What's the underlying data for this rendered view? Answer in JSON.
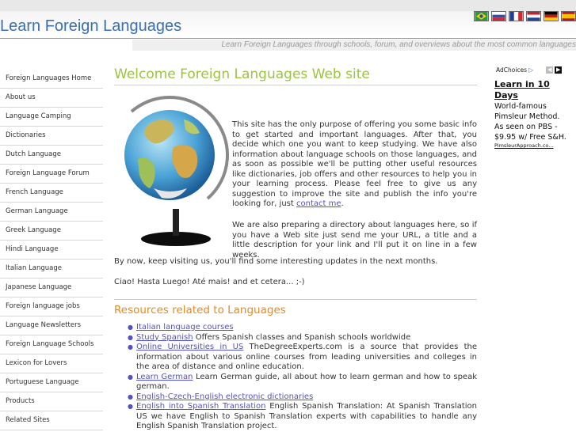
{
  "site": {
    "title": "Learn Foreign Languages",
    "tagline": "Learn Foreign Languages through schools, forum, and overviews about the most common languages"
  },
  "flags": [
    {
      "name": "brazil-flag",
      "colors": [
        "#2a9a3a",
        "#f4d21b",
        "#2c4aa0"
      ]
    },
    {
      "name": "russia-flag",
      "colors": [
        "#ffffff",
        "#2b50b5",
        "#d6262e"
      ]
    },
    {
      "name": "france-flag",
      "colors": [
        "#1f3e9c",
        "#ffffff",
        "#d6262e"
      ]
    },
    {
      "name": "netherlands-flag",
      "colors": [
        "#c8202e",
        "#ffffff",
        "#20439b"
      ]
    },
    {
      "name": "germany-flag",
      "colors": [
        "#000000",
        "#dd1010",
        "#ffcc00"
      ]
    },
    {
      "name": "spain-flag",
      "colors": [
        "#c7102e",
        "#f3c300",
        "#c7102e"
      ]
    }
  ],
  "sidebar": {
    "items": [
      {
        "label": "Foreign Languages Home"
      },
      {
        "label": "About us"
      },
      {
        "label": "Language Camping"
      },
      {
        "label": "Dictionaries"
      },
      {
        "label": "Dutch Language"
      },
      {
        "label": "Foreign Language Forum"
      },
      {
        "label": "French Language"
      },
      {
        "label": "German Language"
      },
      {
        "label": "Greek Language"
      },
      {
        "label": "Hindi Language"
      },
      {
        "label": "Italian Language"
      },
      {
        "label": "Japanese Language"
      },
      {
        "label": "Foreign language jobs"
      },
      {
        "label": "Language Newsletters"
      },
      {
        "label": "Foreign Language Schools"
      },
      {
        "label": "Lexicon for Lovers"
      },
      {
        "label": "Portuguese Language"
      },
      {
        "label": "Products"
      },
      {
        "label": "Related Sites"
      }
    ]
  },
  "main": {
    "title": "Welcome Foreign Languages Web site",
    "intro_text": "This site has the only purpose of offering you some basic info to get started and important languages. After that, you decide which one you want to keep studying. We have also information about language schools on those languages, and as soon as possible we'll be putting other useful resources like dictionaries, job offers and other resources to help you in your learning process. Please feel free to give us any suggestion to improve the site and publish the info you're looking for, just ",
    "contact_link": "contact me",
    "intro_end": ".",
    "directory_text": "We are also preparing a directory about languages here, so if you have a Web site just send me your URL, a title and a little description for your link and I'll put it on line in a few weeks.",
    "updates_text": "By now, keep visiting us, you'll find some interesting updates in the next months.",
    "farewell_text": "Ciao! Hasta Luego! Até mais! and et cetera... ;-)",
    "resources_title": "Resources related to Languages",
    "resources": [
      {
        "link": "Italian language courses",
        "text": ""
      },
      {
        "link": "Study Spanish",
        "text": " Offers Spanish classes and Spanish schools worldwide"
      },
      {
        "link": "Online Universities in US",
        "text": " TheDegreeExperts.com is a source that provides the information about various online courses from leading universities and colleges in the area of distance and online education."
      },
      {
        "link": "Learn German",
        "text": " Learn German guide, all about how to learn german and how to speak german."
      },
      {
        "link": "English-Czech-English electronic dictionaries",
        "text": ""
      },
      {
        "link": "English into Spanish Translation",
        "text": " English Spanish Translation: At Spanish Translation US we have English to Spanish Translation experts with capabilities to handle any English Spanish Translation project."
      }
    ]
  },
  "ad": {
    "choices_label": "AdChoices",
    "title": "Learn in 10 Days",
    "body": "World-famous Pimsleur Method. As seen on PBS - $9.95 w/ Free S&H.",
    "url": "PimsleurApproach.co..."
  },
  "colors": {
    "title_blue": "#3c6fae",
    "heading_green": "#9bc43f",
    "section_orange": "#e8891e",
    "link": "#5252c0"
  }
}
